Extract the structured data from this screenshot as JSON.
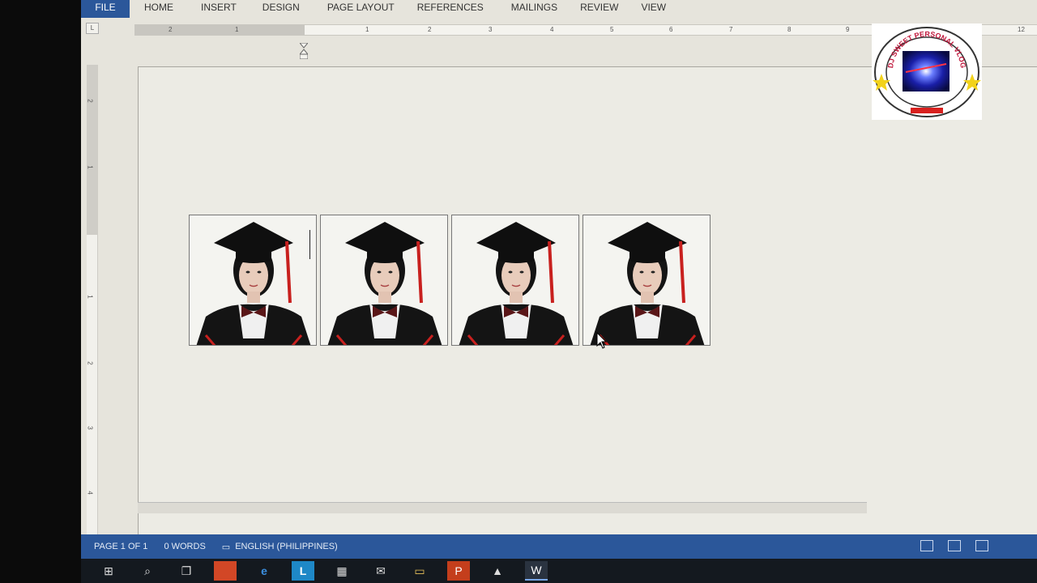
{
  "ribbon": {
    "tabs": [
      "FILE",
      "HOME",
      "INSERT",
      "DESIGN",
      "PAGE LAYOUT",
      "REFERENCES",
      "MAILINGS",
      "REVIEW",
      "VIEW"
    ]
  },
  "ruler": {
    "left_numbers": [
      "2",
      "1"
    ],
    "right_numbers": [
      "1",
      "2",
      "3",
      "4",
      "5",
      "6",
      "7",
      "8",
      "9",
      "12"
    ],
    "tab_selector": "L"
  },
  "vertical_ruler": {
    "numbers": [
      "2",
      "1",
      "1",
      "2",
      "3",
      "4"
    ]
  },
  "document": {
    "photos": [
      {
        "subject": "graduation-portrait"
      },
      {
        "subject": "graduation-portrait"
      },
      {
        "subject": "graduation-portrait"
      },
      {
        "subject": "graduation-portrait"
      }
    ]
  },
  "statusbar": {
    "page": "PAGE 1 OF 1",
    "words": "0 WORDS",
    "language": "ENGLISH (PHILIPPINES)"
  },
  "taskbar": {
    "icons": [
      "windows-icon",
      "search-icon",
      "task-view-icon",
      "app-icon",
      "edge-icon",
      "l-app-icon",
      "store-icon",
      "mail-icon",
      "file-explorer-icon",
      "powerpoint-icon",
      "photos-icon",
      "word-icon"
    ]
  },
  "watermark": {
    "logo_text": "DJ SWEET PERSONAL VLOG"
  },
  "colors": {
    "accent": "#2b579a",
    "tassel": "#c8201e"
  }
}
